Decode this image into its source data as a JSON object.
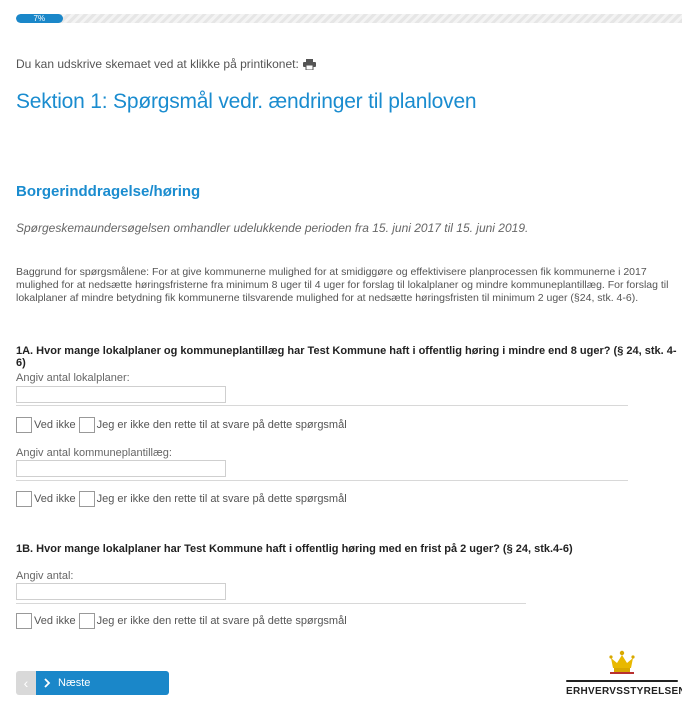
{
  "progress": {
    "percent": 7,
    "label": "7%"
  },
  "print_hint": "Du kan udskrive skemaet ved at klikke på printikonet:",
  "section_title": "Sektion 1: Spørgsmål vedr. ændringer til planloven",
  "subsection_title": "Borgerinddragelse/høring",
  "intro_italic": "Spørgeskemaundersøgelsen omhandler udelukkende perioden fra 15. juni 2017 til 15. juni 2019.",
  "background_text": "Baggrund for spørgsmålene: For at give kommunerne mulighed for at smidiggøre og effektivisere planprocessen fik kommunerne i 2017 mulighed for at nedsætte høringsfristerne fra minimum 8 uger til 4 uger for forslag til lokalplaner og mindre kommuneplantillæg. For forslag til lokalplaner af mindre betydning fik kommunerne tilsvarende mulighed for at nedsætte høringsfristen til minimum 2 uger (§24, stk. 4-6).",
  "q1a": {
    "title": "1A. Hvor mange lokalplaner og kommuneplantillæg har Test Kommune haft i offentlig høring i mindre end 8 uger? (§ 24, stk. 4-6)",
    "label_1": "Angiv antal lokalplaner:",
    "label_2": "Angiv antal kommuneplantillæg:",
    "value_1": "",
    "value_2": ""
  },
  "q1b": {
    "title": "1B. Hvor mange lokalplaner har Test Kommune haft i offentlig høring med en frist på 2 uger? (§ 24, stk.4-6)",
    "label_1": "Angiv antal:",
    "value_1": ""
  },
  "checkboxes": {
    "dont_know": "Ved ikke",
    "not_right_person": "Jeg er ikke den rette til at svare på dette spørgsmål"
  },
  "nav": {
    "prev_label": "‹",
    "next_label": "Næste"
  },
  "logo": {
    "text": "ERHVERVSSTYRELSEN"
  },
  "colors": {
    "accent": "#1a87c9",
    "title": "#1a8ccf"
  }
}
